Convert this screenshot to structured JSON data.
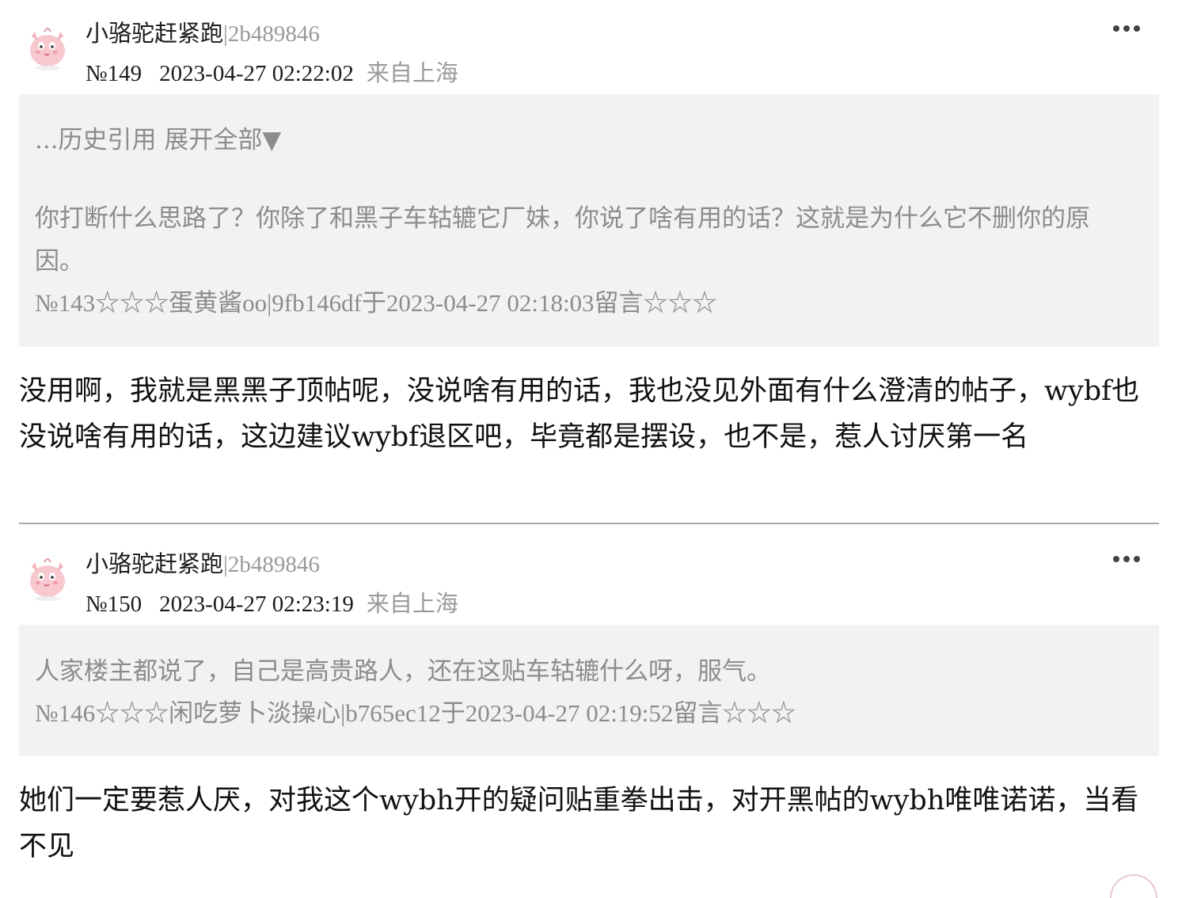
{
  "posts": [
    {
      "username": "小骆驼赶紧跑",
      "user_id": "|2b489846",
      "floor": "№149",
      "time": "2023-04-27 02:22:02",
      "location": "来自上海",
      "quote": {
        "history_link": "...历史引用 展开全部▼",
        "text": "你打断什么思路了？你除了和黑子车轱辘它厂妹，你说了啥有用的话？这就是为什么它不删你的原因。",
        "ref": "№143☆☆☆蛋黄酱oo|9fb146df于2023-04-27 02:18:03留言☆☆☆"
      },
      "content": "没用啊，我就是黑黑子顶帖呢，没说啥有用的话，我也没见外面有什么澄清的帖子，wybf也没说啥有用的话，这边建议wybf退区吧，毕竟都是摆设，也不是，惹人讨厌第一名"
    },
    {
      "username": "小骆驼赶紧跑",
      "user_id": "|2b489846",
      "floor": "№150",
      "time": "2023-04-27 02:23:19",
      "location": "来自上海",
      "quote": {
        "text": "人家楼主都说了，自己是高贵路人，还在这贴车轱辘什么呀，服气。",
        "ref": "№146☆☆☆闲吃萝卜淡操心|b765ec12于2023-04-27 02:19:52留言☆☆☆"
      },
      "content": "她们一定要惹人厌，对我这个wybh开的疑问贴重拳出击，对开黑帖的wybh唯唯诺诺，当看不见"
    }
  ],
  "icons": {
    "avatar": "clefairy-avatar-icon",
    "more": "more-options-icon"
  },
  "colors": {
    "quote_bg": "#f2f2f2",
    "muted_text": "#8c8c8c",
    "divider": "#a9a9a9"
  }
}
